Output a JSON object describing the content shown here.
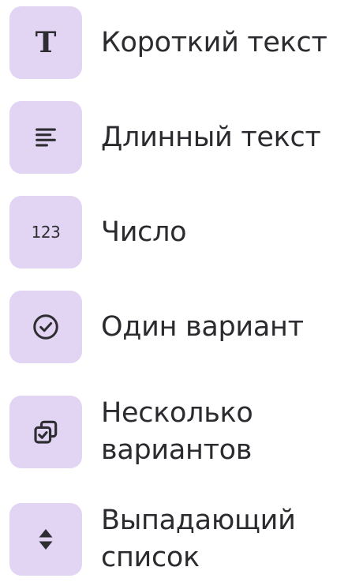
{
  "field_types": [
    {
      "id": "short_text",
      "icon": "text-t-icon",
      "label": "Короткий текст"
    },
    {
      "id": "long_text",
      "icon": "paragraph-lines-icon",
      "label": "Длинный текст"
    },
    {
      "id": "number",
      "icon": "numbers-123-icon",
      "icon_text": "123",
      "label": "Число"
    },
    {
      "id": "single_choice",
      "icon": "check-circle-icon",
      "label": "Один вариант"
    },
    {
      "id": "multiple_choice",
      "icon": "stacked-checkboxes-icon",
      "label_line1": "Несколько",
      "label_line2": "вариантов"
    },
    {
      "id": "dropdown",
      "icon": "up-down-arrows-icon",
      "label_line1": "Выпадающий",
      "label_line2": "список"
    }
  ],
  "colors": {
    "tile_background": "#e2d4f3",
    "icon": "#2e2e32",
    "text": "#2b2b2f"
  }
}
